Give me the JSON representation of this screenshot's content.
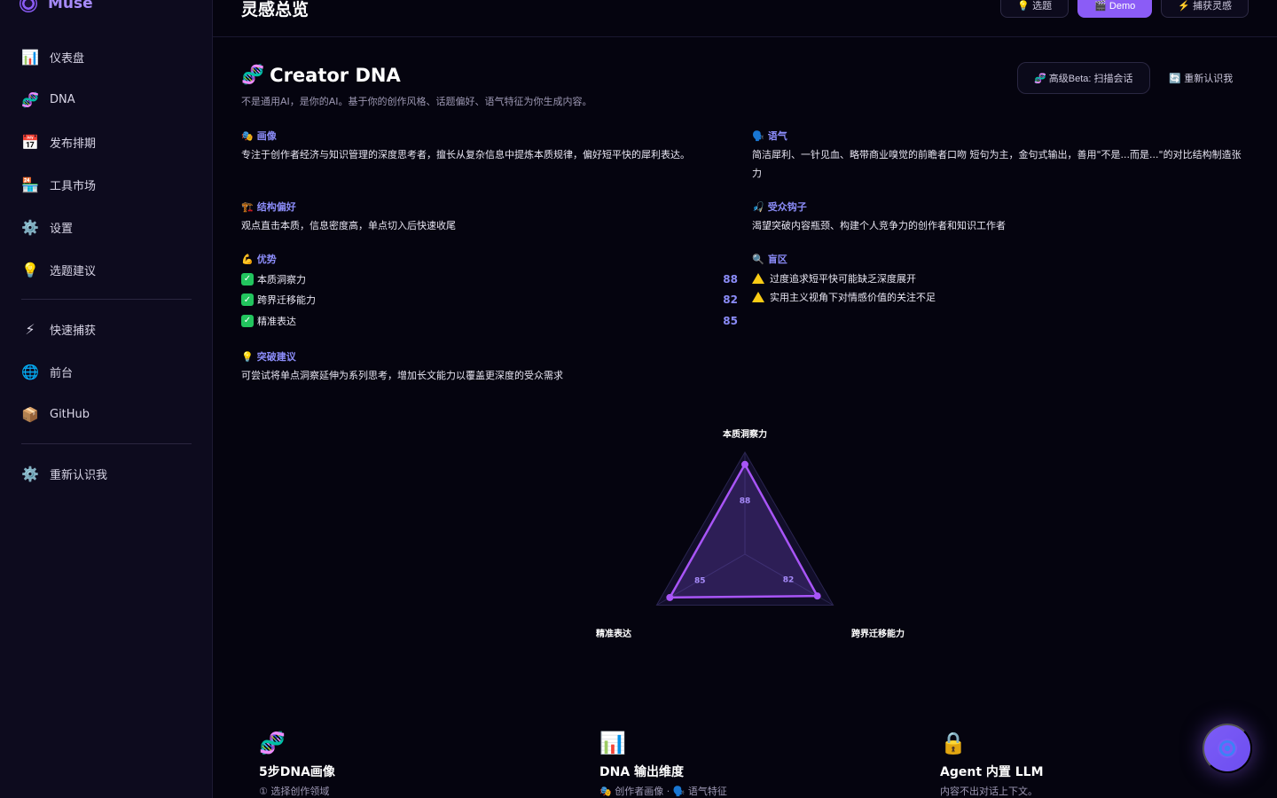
{
  "app": {
    "name": "Muse"
  },
  "sidebar": {
    "items": [
      {
        "icon": "📊",
        "label": "仪表盘"
      },
      {
        "icon": "🧬",
        "label": "DNA"
      },
      {
        "icon": "📅",
        "label": "发布排期"
      },
      {
        "icon": "🏪",
        "label": "工具市场"
      },
      {
        "icon": "⚙️",
        "label": "设置"
      },
      {
        "icon": "💡",
        "label": "选题建议"
      }
    ],
    "items2": [
      {
        "icon": "⚡",
        "label": "快速捕获"
      },
      {
        "icon": "🌐",
        "label": "前台"
      },
      {
        "icon": "📦",
        "label": "GitHub"
      }
    ],
    "items3": [
      {
        "icon": "⚙️",
        "label": "重新认识我"
      }
    ]
  },
  "topbar": {
    "title": "灵感总览",
    "btn_topic": "💡 选题",
    "btn_demo": "🎬 Demo",
    "btn_capture": "⚡ 捕获灵感"
  },
  "dna": {
    "title": "Creator DNA",
    "title_icon": "🧬",
    "subtitle": "不是通用AI，是你的AI。基于你的创作风格、话题偏好、语气特征为你生成内容。",
    "scan_btn": "🧬 高级Beta: 扫描会话",
    "reknow_btn": "🔄 重新认识我",
    "persona": {
      "icon": "🎭",
      "head": "画像",
      "body": "专注于创作者经济与知识管理的深度思考者，擅长从复杂信息中提炼本质规律，偏好短平快的犀利表达。"
    },
    "tone": {
      "icon": "🗣️",
      "head": "语气",
      "body": "简洁犀利、一针见血、略带商业嗅觉的前瞻者口吻 短句为主，金句式输出，善用\"不是...而是...\"的对比结构制造张力"
    },
    "structure": {
      "icon": "🏗️",
      "head": "结构偏好",
      "body": "观点直击本质，信息密度高，单点切入后快速收尾"
    },
    "audience": {
      "icon": "🎣",
      "head": "受众钩子",
      "body": "渴望突破内容瓶颈、构建个人竞争力的创作者和知识工作者"
    },
    "strengths": {
      "icon": "💪",
      "head": "优势",
      "items": [
        {
          "label": "本质洞察力",
          "score": "88"
        },
        {
          "label": "跨界迁移能力",
          "score": "82"
        },
        {
          "label": "精准表达",
          "score": "85"
        }
      ]
    },
    "blindspots": {
      "icon": "🔍",
      "head": "盲区",
      "items": [
        "过度追求短平快可能缺乏深度展开",
        "实用主义视角下对情感价值的关注不足"
      ]
    },
    "breakthrough": {
      "icon": "💡",
      "head": "突破建议",
      "body": "可尝试将单点洞察延伸为系列思考，增加长文能力以覆盖更深度的受众需求"
    }
  },
  "chart_data": {
    "type": "radar",
    "categories": [
      "本质洞察力",
      "跨界迁移能力",
      "精准表达"
    ],
    "values": [
      88,
      82,
      85
    ],
    "range": [
      0,
      100
    ],
    "color": "#a855f7"
  },
  "features": [
    {
      "icon": "🧬",
      "title": "5步DNA画像",
      "sub": "① 选择创作领域"
    },
    {
      "icon": "📊",
      "title": "DNA 输出维度",
      "sub": "🎭 创作者画像 · 🗣️ 语气特征"
    },
    {
      "icon": "🔒",
      "title": "Agent 内置 LLM",
      "sub": "内容不出对话上下文。"
    }
  ]
}
